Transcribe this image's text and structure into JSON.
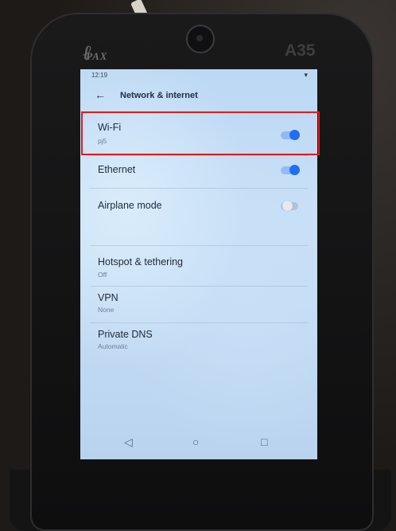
{
  "device": {
    "brand": "PAX",
    "model": "A35"
  },
  "status_bar": {
    "time": "12:19"
  },
  "header": {
    "back_icon": "arrow-left-icon",
    "title": "Network & internet"
  },
  "settings": [
    {
      "title": "Wi-Fi",
      "subtitle": "pj5",
      "toggle": "on"
    },
    {
      "title": "Ethernet",
      "subtitle": "",
      "toggle": "on"
    },
    {
      "title": "Airplane mode",
      "subtitle": "",
      "toggle": "off"
    },
    {
      "title": "Hotspot & tethering",
      "subtitle": "Off"
    },
    {
      "title": "VPN",
      "subtitle": "None"
    },
    {
      "title": "Private DNS",
      "subtitle": "Automatic"
    }
  ],
  "nav": {
    "back": "◁",
    "home": "○",
    "recents": "□"
  },
  "colors": {
    "accent": "#1f6ff0",
    "highlight": "#e21b1b"
  }
}
